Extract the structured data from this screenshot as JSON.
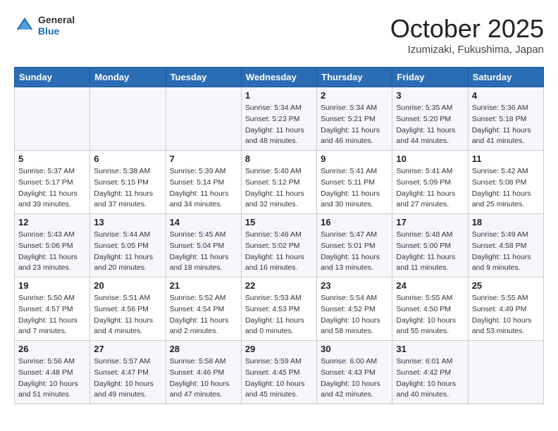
{
  "header": {
    "logo": {
      "general": "General",
      "blue": "Blue"
    },
    "month": "October 2025",
    "location": "Izumizaki, Fukushima, Japan"
  },
  "weekdays": [
    "Sunday",
    "Monday",
    "Tuesday",
    "Wednesday",
    "Thursday",
    "Friday",
    "Saturday"
  ],
  "weeks": [
    [
      {
        "day": "",
        "info": ""
      },
      {
        "day": "",
        "info": ""
      },
      {
        "day": "",
        "info": ""
      },
      {
        "day": "1",
        "sunrise": "Sunrise: 5:34 AM",
        "sunset": "Sunset: 5:23 PM",
        "daylight": "Daylight: 11 hours and 48 minutes."
      },
      {
        "day": "2",
        "sunrise": "Sunrise: 5:34 AM",
        "sunset": "Sunset: 5:21 PM",
        "daylight": "Daylight: 11 hours and 46 minutes."
      },
      {
        "day": "3",
        "sunrise": "Sunrise: 5:35 AM",
        "sunset": "Sunset: 5:20 PM",
        "daylight": "Daylight: 11 hours and 44 minutes."
      },
      {
        "day": "4",
        "sunrise": "Sunrise: 5:36 AM",
        "sunset": "Sunset: 5:18 PM",
        "daylight": "Daylight: 11 hours and 41 minutes."
      }
    ],
    [
      {
        "day": "5",
        "sunrise": "Sunrise: 5:37 AM",
        "sunset": "Sunset: 5:17 PM",
        "daylight": "Daylight: 11 hours and 39 minutes."
      },
      {
        "day": "6",
        "sunrise": "Sunrise: 5:38 AM",
        "sunset": "Sunset: 5:15 PM",
        "daylight": "Daylight: 11 hours and 37 minutes."
      },
      {
        "day": "7",
        "sunrise": "Sunrise: 5:39 AM",
        "sunset": "Sunset: 5:14 PM",
        "daylight": "Daylight: 11 hours and 34 minutes."
      },
      {
        "day": "8",
        "sunrise": "Sunrise: 5:40 AM",
        "sunset": "Sunset: 5:12 PM",
        "daylight": "Daylight: 11 hours and 32 minutes."
      },
      {
        "day": "9",
        "sunrise": "Sunrise: 5:41 AM",
        "sunset": "Sunset: 5:11 PM",
        "daylight": "Daylight: 11 hours and 30 minutes."
      },
      {
        "day": "10",
        "sunrise": "Sunrise: 5:41 AM",
        "sunset": "Sunset: 5:09 PM",
        "daylight": "Daylight: 11 hours and 27 minutes."
      },
      {
        "day": "11",
        "sunrise": "Sunrise: 5:42 AM",
        "sunset": "Sunset: 5:08 PM",
        "daylight": "Daylight: 11 hours and 25 minutes."
      }
    ],
    [
      {
        "day": "12",
        "sunrise": "Sunrise: 5:43 AM",
        "sunset": "Sunset: 5:06 PM",
        "daylight": "Daylight: 11 hours and 23 minutes."
      },
      {
        "day": "13",
        "sunrise": "Sunrise: 5:44 AM",
        "sunset": "Sunset: 5:05 PM",
        "daylight": "Daylight: 11 hours and 20 minutes."
      },
      {
        "day": "14",
        "sunrise": "Sunrise: 5:45 AM",
        "sunset": "Sunset: 5:04 PM",
        "daylight": "Daylight: 11 hours and 18 minutes."
      },
      {
        "day": "15",
        "sunrise": "Sunrise: 5:46 AM",
        "sunset": "Sunset: 5:02 PM",
        "daylight": "Daylight: 11 hours and 16 minutes."
      },
      {
        "day": "16",
        "sunrise": "Sunrise: 5:47 AM",
        "sunset": "Sunset: 5:01 PM",
        "daylight": "Daylight: 11 hours and 13 minutes."
      },
      {
        "day": "17",
        "sunrise": "Sunrise: 5:48 AM",
        "sunset": "Sunset: 5:00 PM",
        "daylight": "Daylight: 11 hours and 11 minutes."
      },
      {
        "day": "18",
        "sunrise": "Sunrise: 5:49 AM",
        "sunset": "Sunset: 4:58 PM",
        "daylight": "Daylight: 11 hours and 9 minutes."
      }
    ],
    [
      {
        "day": "19",
        "sunrise": "Sunrise: 5:50 AM",
        "sunset": "Sunset: 4:57 PM",
        "daylight": "Daylight: 11 hours and 7 minutes."
      },
      {
        "day": "20",
        "sunrise": "Sunrise: 5:51 AM",
        "sunset": "Sunset: 4:56 PM",
        "daylight": "Daylight: 11 hours and 4 minutes."
      },
      {
        "day": "21",
        "sunrise": "Sunrise: 5:52 AM",
        "sunset": "Sunset: 4:54 PM",
        "daylight": "Daylight: 11 hours and 2 minutes."
      },
      {
        "day": "22",
        "sunrise": "Sunrise: 5:53 AM",
        "sunset": "Sunset: 4:53 PM",
        "daylight": "Daylight: 11 hours and 0 minutes."
      },
      {
        "day": "23",
        "sunrise": "Sunrise: 5:54 AM",
        "sunset": "Sunset: 4:52 PM",
        "daylight": "Daylight: 10 hours and 58 minutes."
      },
      {
        "day": "24",
        "sunrise": "Sunrise: 5:55 AM",
        "sunset": "Sunset: 4:50 PM",
        "daylight": "Daylight: 10 hours and 55 minutes."
      },
      {
        "day": "25",
        "sunrise": "Sunrise: 5:55 AM",
        "sunset": "Sunset: 4:49 PM",
        "daylight": "Daylight: 10 hours and 53 minutes."
      }
    ],
    [
      {
        "day": "26",
        "sunrise": "Sunrise: 5:56 AM",
        "sunset": "Sunset: 4:48 PM",
        "daylight": "Daylight: 10 hours and 51 minutes."
      },
      {
        "day": "27",
        "sunrise": "Sunrise: 5:57 AM",
        "sunset": "Sunset: 4:47 PM",
        "daylight": "Daylight: 10 hours and 49 minutes."
      },
      {
        "day": "28",
        "sunrise": "Sunrise: 5:58 AM",
        "sunset": "Sunset: 4:46 PM",
        "daylight": "Daylight: 10 hours and 47 minutes."
      },
      {
        "day": "29",
        "sunrise": "Sunrise: 5:59 AM",
        "sunset": "Sunset: 4:45 PM",
        "daylight": "Daylight: 10 hours and 45 minutes."
      },
      {
        "day": "30",
        "sunrise": "Sunrise: 6:00 AM",
        "sunset": "Sunset: 4:43 PM",
        "daylight": "Daylight: 10 hours and 42 minutes."
      },
      {
        "day": "31",
        "sunrise": "Sunrise: 6:01 AM",
        "sunset": "Sunset: 4:42 PM",
        "daylight": "Daylight: 10 hours and 40 minutes."
      },
      {
        "day": "",
        "info": ""
      }
    ]
  ]
}
